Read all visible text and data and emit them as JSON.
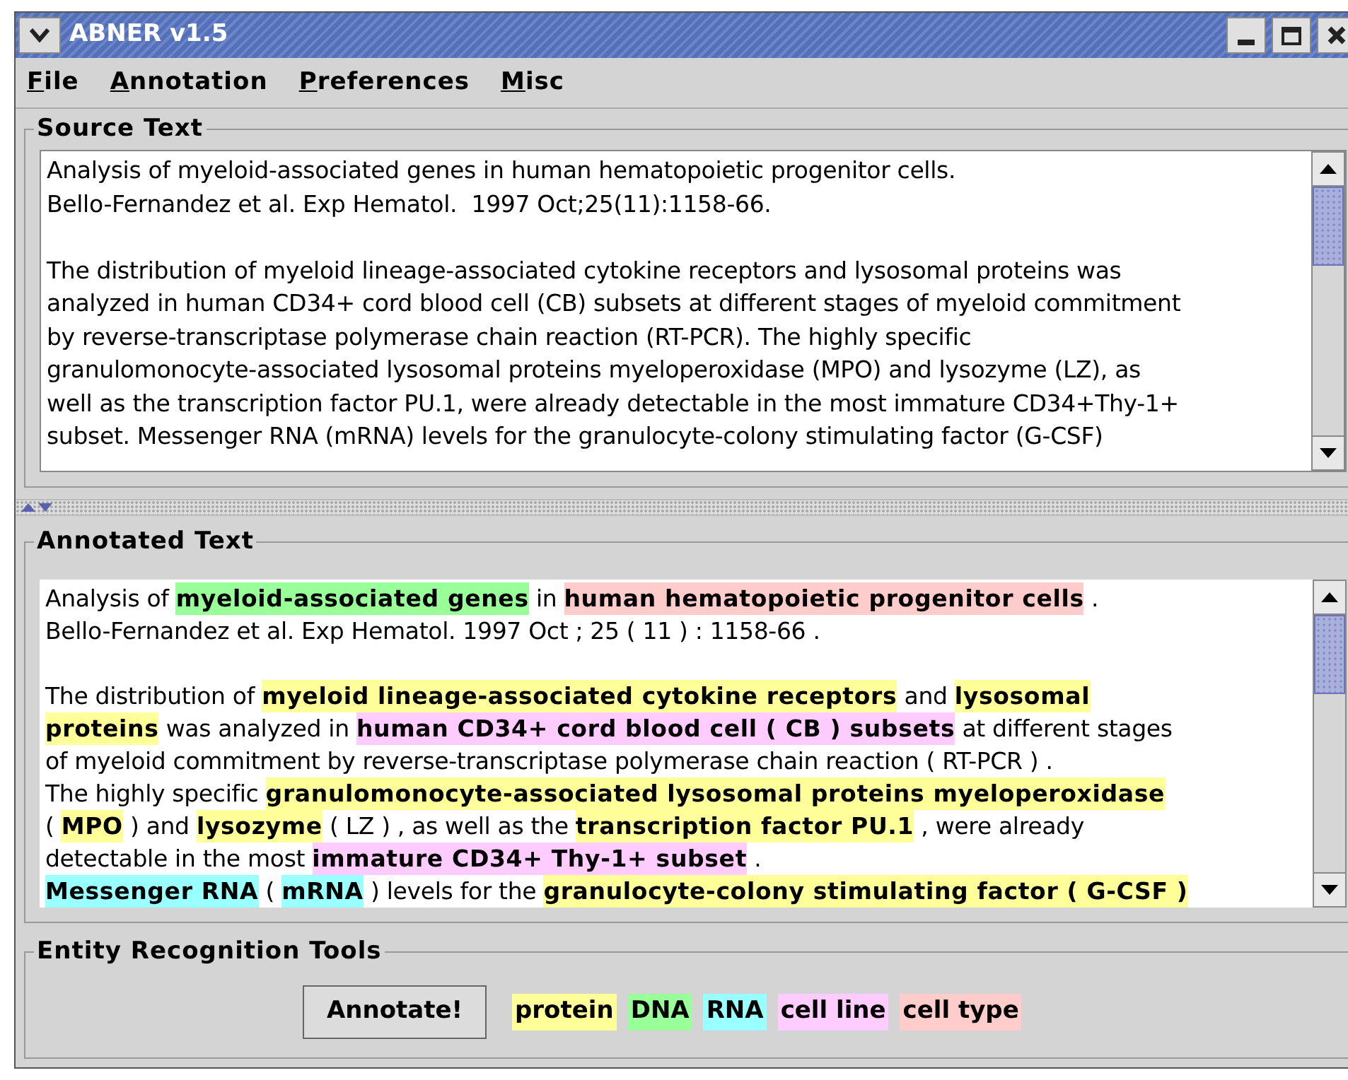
{
  "window": {
    "title": "ABNER v1.5"
  },
  "menu": [
    "File",
    "Annotation",
    "Preferences",
    "Misc"
  ],
  "source_text": {
    "title": "Source Text",
    "paragraphs": [
      [
        "Analysis of myeloid-associated genes in human hematopoietic progenitor cells.",
        "Bello-Fernandez et al. Exp Hematol.  1997 Oct;25(11):1158-66."
      ],
      [
        "The distribution of myeloid lineage-associated cytokine receptors and lysosomal proteins was",
        "analyzed in human CD34+ cord blood cell (CB) subsets at different stages of myeloid commitment",
        "by reverse-transcriptase polymerase chain reaction (RT-PCR). The highly specific",
        "granulomonocyte-associated lysosomal proteins myeloperoxidase (MPO) and lysozyme (LZ), as",
        "well as the transcription factor PU.1, were already detectable in the most immature CD34+Thy-1+",
        "subset. Messenger RNA (mRNA) levels for the granulocyte-colony stimulating factor (G-CSF)"
      ]
    ]
  },
  "annotated_text": {
    "title": "Annotated Text",
    "paragraphs": [
      [
        [
          {
            "text": "Analysis of "
          },
          {
            "text": "myeloid-associated genes",
            "color": "#99ff99"
          },
          {
            "text": " in "
          },
          {
            "text": "human hematopoietic progenitor cells",
            "color": "#ffcccc"
          },
          {
            "text": " ."
          }
        ],
        [
          {
            "text": "Bello-Fernandez et al. Exp Hematol. 1997 Oct ; 25 ( 11 ) : 1158-66 ."
          }
        ]
      ],
      [
        [
          {
            "text": "The distribution of "
          },
          {
            "text": "myeloid lineage-associated cytokine receptors",
            "color": "#ffff99"
          },
          {
            "text": " and "
          },
          {
            "text": "lysosomal",
            "color": "#ffff99"
          }
        ],
        [
          {
            "text": "proteins",
            "color": "#ffff99"
          },
          {
            "text": " was analyzed in "
          },
          {
            "text": "human CD34+ cord blood cell ( CB ) subsets",
            "color": "#ffccff"
          },
          {
            "text": " at different stages"
          }
        ],
        [
          {
            "text": "of myeloid commitment by reverse-transcriptase polymerase chain reaction ( RT-PCR ) ."
          }
        ],
        [
          {
            "text": "The highly specific "
          },
          {
            "text": "granulomonocyte-associated lysosomal proteins myeloperoxidase",
            "color": "#ffff99"
          }
        ],
        [
          {
            "text": "( "
          },
          {
            "text": "MPO",
            "color": "#ffff99"
          },
          {
            "text": " ) and "
          },
          {
            "text": "lysozyme",
            "color": "#ffff99"
          },
          {
            "text": " ( LZ ) , as well as the "
          },
          {
            "text": "transcription factor PU.1",
            "color": "#ffff99"
          },
          {
            "text": " , were already"
          }
        ],
        [
          {
            "text": "detectable in the most "
          },
          {
            "text": "immature CD34+ Thy-1+ subset",
            "color": "#ffccff"
          },
          {
            "text": " ."
          }
        ],
        [
          {
            "text": "Messenger RNA",
            "color": "#99ffff"
          },
          {
            "text": " ( "
          },
          {
            "text": "mRNA",
            "color": "#99ffff"
          },
          {
            "text": " ) levels for the "
          },
          {
            "text": "granulocyte-colony stimulating factor ( G-CSF )",
            "color": "#ffff99"
          }
        ]
      ]
    ]
  },
  "tools": {
    "title": "Entity Recognition Tools",
    "button": "Annotate!",
    "legend": [
      {
        "label": "protein",
        "color": "#ffff99"
      },
      {
        "label": "DNA",
        "color": "#99ff99"
      },
      {
        "label": "RNA",
        "color": "#99ffff"
      },
      {
        "label": "cell line",
        "color": "#ffccff"
      },
      {
        "label": "cell type",
        "color": "#ffcccc"
      }
    ]
  }
}
